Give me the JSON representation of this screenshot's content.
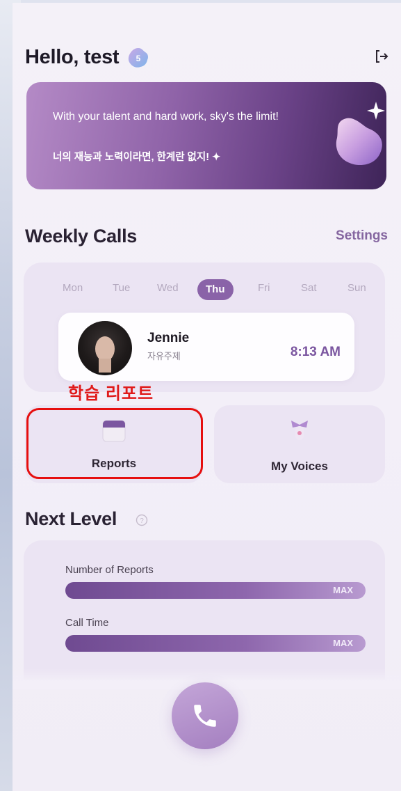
{
  "header": {
    "greeting": "Hello, test",
    "level": "5"
  },
  "banner": {
    "english": "With your talent and hard work, sky's the limit!",
    "korean": "너의 재능과 노력이라면, 한계란 없지! ✦"
  },
  "weekly_calls": {
    "title": "Weekly Calls",
    "settings_label": "Settings",
    "days": [
      "Mon",
      "Tue",
      "Wed",
      "Thu",
      "Fri",
      "Sat",
      "Sun"
    ],
    "selected_day": "Thu",
    "call": {
      "name": "Jennie",
      "topic": "자유주제",
      "time": "8:13 AM"
    }
  },
  "annotation": {
    "label": "학습 리포트",
    "color": "#e60f0f"
  },
  "tiles": {
    "reports_label": "Reports",
    "voices_label": "My Voices"
  },
  "next_level": {
    "title": "Next Level",
    "metrics": [
      {
        "label": "Number of Reports",
        "status": "MAX",
        "progress": 1.0
      },
      {
        "label": "Call Time",
        "status": "MAX",
        "progress": 1.0
      }
    ]
  },
  "colors": {
    "accent": "#8a63a8",
    "text_dark": "#1e1a27",
    "card_bg": "#ebe4f3"
  },
  "icons": [
    "level-badge-icon",
    "logout-icon",
    "sparkle-icon",
    "calendar-icon",
    "ribbon-icon",
    "help-icon",
    "phone-icon"
  ]
}
